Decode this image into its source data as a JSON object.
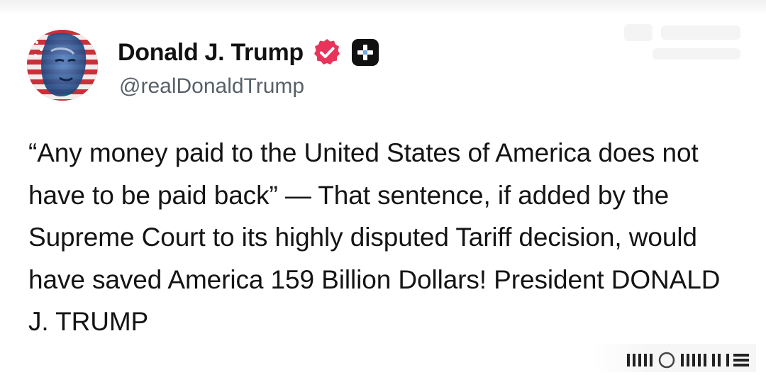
{
  "author": {
    "name": "Donald J. Trump",
    "handle": "@realDonaldTrump",
    "avatar_icon": "avatar-flag-portrait",
    "verified_icon": "verified-badge-icon",
    "plus_icon": "plus-icon"
  },
  "post": {
    "text": "“Any money paid to the United States of America does not have to be paid back” — That sentence, if added by the Supreme Court to its highly disputed Tariff decision, would have saved America 159 Billion Dollars! President DONALD J. TRUMP"
  },
  "colors": {
    "verified_badge": "#e8345b",
    "plus_badge": "#111111",
    "text": "#141414",
    "handle": "#586069"
  }
}
